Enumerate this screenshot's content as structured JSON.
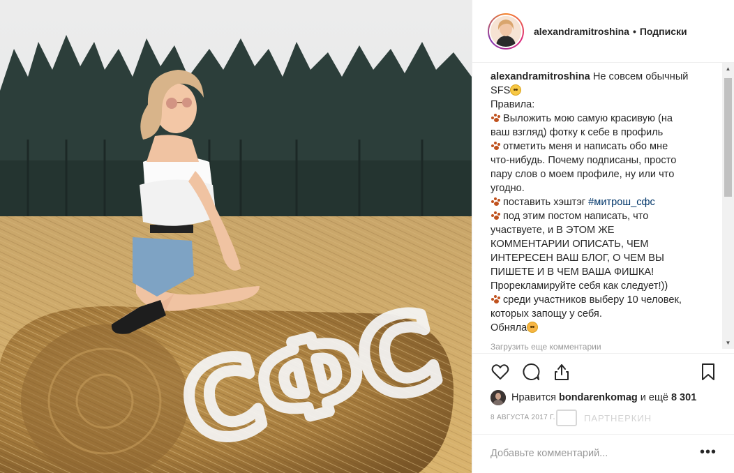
{
  "post": {
    "username": "alexandramitroshina",
    "separator": "•",
    "follow_label": "Подписки",
    "overlay_text": "СФС"
  },
  "caption": {
    "username": "alexandramitroshina",
    "line1": "Не совсем обычный",
    "line2": "SFS",
    "line3": "Правила:",
    "line4": "Выложить мою самую красивую (на",
    "line5": "ваш взгляд) фотку к себе в профиль",
    "line6": "отметить меня и написать обо мне",
    "line7": "что-нибудь. Почему подписаны, просто",
    "line8": "пару слов о моем профиле, ну или что",
    "line9": "угодно.",
    "line10_prefix": "поставить хэштэг ",
    "hashtag": "#митрош_сфс",
    "line11": "под этим постом написать, что",
    "line12": "участвуете, и В ЭТОМ ЖЕ",
    "line13": "КОММЕНТАРИИ ОПИСАТЬ, ЧЕМ",
    "line14": "ИНТЕРЕСЕН ВАШ БЛОГ, О ЧЕМ ВЫ",
    "line15": "ПИШЕТЕ И В ЧЕМ ВАША ФИШКА!",
    "line16": "Прорекламируйте себя как следует!))",
    "line17": "среди участников выберу 10 человек,",
    "line18": "которых запощу у себя.",
    "line19": "Обняла",
    "load_more": "Загрузить еще комментарии"
  },
  "icons": {
    "like": "heart-icon",
    "comment": "comment-icon",
    "share": "share-icon",
    "save": "bookmark-icon",
    "more": "more-icon"
  },
  "likes": {
    "prefix": "Нравится",
    "user": "bondarenkomag",
    "middle": "и ещё",
    "count": "8 301"
  },
  "date": "8 АВГУСТА 2017 Г.",
  "watermark": "ПАРТНЕРКИН",
  "comment": {
    "placeholder": "Добавьте комментарий...",
    "more_label": "•••"
  },
  "colors": {
    "accent": "#003569",
    "muted": "#999999",
    "border": "#efefef",
    "paw": "#c0521e"
  }
}
